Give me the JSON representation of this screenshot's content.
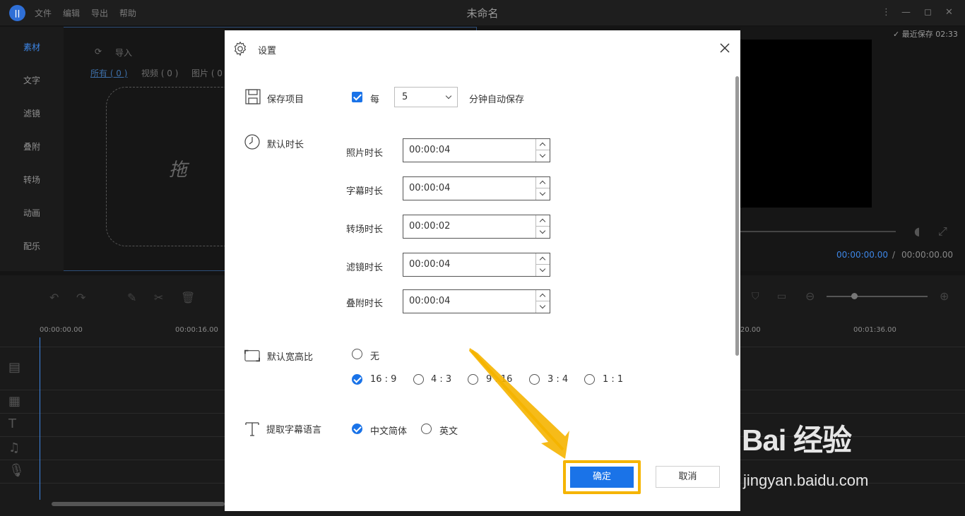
{
  "app": {
    "logo": "logo-icon",
    "menu": [
      "文件",
      "编辑",
      "导出",
      "帮助"
    ],
    "window_title": "未命名",
    "autosave": "最近保存 02:33"
  },
  "left_nav": [
    "素材",
    "文字",
    "滤镜",
    "叠附",
    "转场",
    "动画",
    "配乐"
  ],
  "media": {
    "import": "导入",
    "filters": [
      "所有 ( 0 )",
      "视频 ( 0 )",
      "图片 ( 0 )"
    ],
    "drop_glyph": "拖"
  },
  "preview": {
    "time_current": "00:00:00.00",
    "time_sep": "/",
    "time_total": "00:00:00.00"
  },
  "timeline": {
    "ruler": [
      "00:00:00.00",
      "00:00:16.00",
      "20.00",
      "00:01:36.00"
    ]
  },
  "dialog": {
    "title": "设置",
    "save_project": {
      "label": "保存项目",
      "checked": true,
      "every": "每",
      "interval": "5",
      "suffix": "分钟自动保存"
    },
    "default_duration": {
      "label": "默认时长",
      "items": [
        {
          "label": "照片时长",
          "value": "00:00:04"
        },
        {
          "label": "字幕时长",
          "value": "00:00:04"
        },
        {
          "label": "转场时长",
          "value": "00:00:02"
        },
        {
          "label": "滤镜时长",
          "value": "00:00:04"
        },
        {
          "label": "叠附时长",
          "value": "00:00:04"
        }
      ]
    },
    "aspect_ratio": {
      "label": "默认宽高比",
      "none": "无",
      "options": [
        "16 : 9",
        "4 : 3",
        "9 : 16",
        "3 : 4",
        "1 : 1"
      ],
      "selected": "16 : 9"
    },
    "subtitle_lang": {
      "label": "提取字幕语言",
      "options": [
        "中文简体",
        "英文"
      ],
      "selected": "中文简体"
    },
    "ok": "确定",
    "cancel": "取消"
  },
  "watermark": {
    "brand": "Bai 经验",
    "url": "jingyan.baidu.com"
  },
  "colors": {
    "accent": "#1a73e8",
    "highlight": "#f5b400"
  }
}
